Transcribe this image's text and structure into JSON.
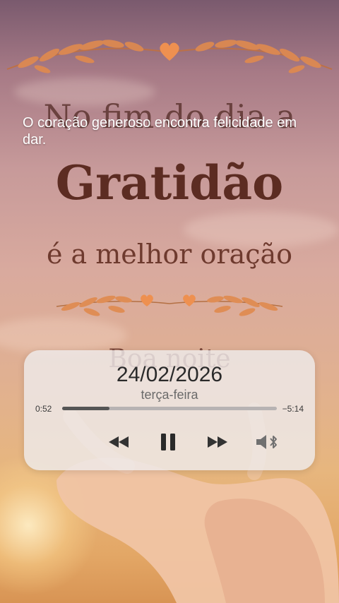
{
  "background": {
    "quote": "O coração generoso encontra felicidade em dar.",
    "line1": "No fim do dia a",
    "title": "Gratidão",
    "line3": "é a melhor oração",
    "line4": "Boa noite"
  },
  "player": {
    "date": "24/02/2026",
    "weekday": "terça-feira",
    "elapsed": "0:52",
    "remaining": "−5:14",
    "progress": 0.22,
    "controls": {
      "back_icon": "rewind-icon",
      "pause_icon": "pause-icon",
      "forward_icon": "fast-forward-icon",
      "output_icon": "speaker-bluetooth-icon"
    }
  },
  "colors": {
    "title": "#5c2c22",
    "wreath_leaf": "#e08a4e",
    "heart": "#ee9050"
  }
}
